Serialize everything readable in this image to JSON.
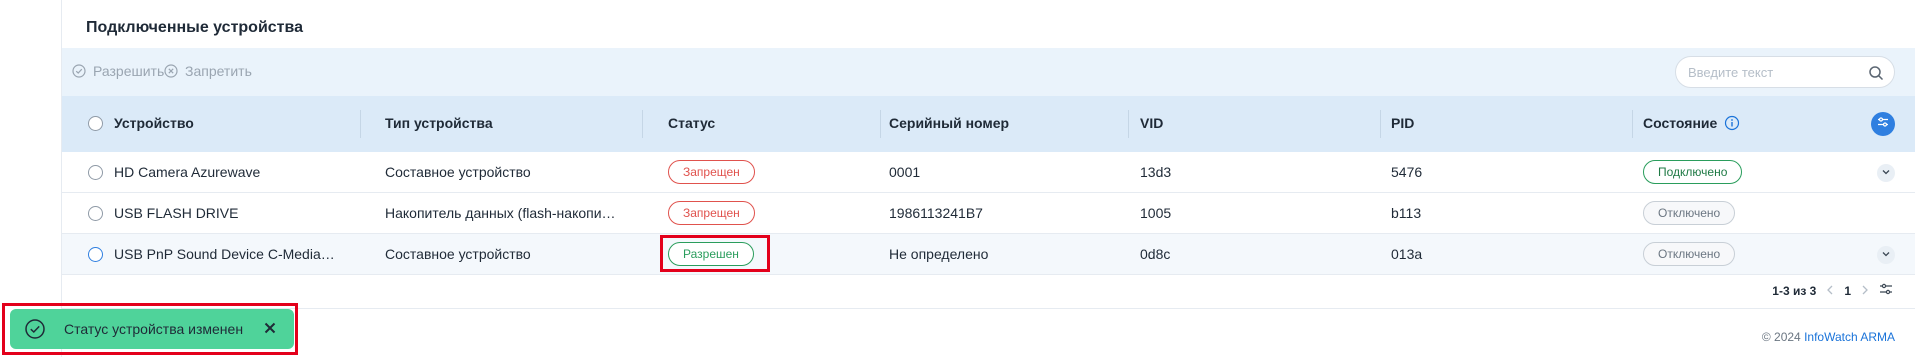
{
  "section": {
    "title": "Подключенные устройства"
  },
  "toolbar": {
    "allow_label": "Разрешить",
    "deny_label": "Запретить",
    "search_placeholder": "Введите текст"
  },
  "table": {
    "headers": {
      "device": "Устройство",
      "type": "Тип устройства",
      "status": "Статус",
      "serial": "Серийный номер",
      "vid": "VID",
      "pid": "PID",
      "state": "Состояние"
    },
    "rows": [
      {
        "device": "HD Camera Azurewave",
        "type": "Составное устройство",
        "status": "Запрещен",
        "serial": "0001",
        "vid": "13d3",
        "pid": "5476",
        "state": "Подключено"
      },
      {
        "device": "USB FLASH DRIVE",
        "type": "Накопитель данных (flash-накопи…",
        "status": "Запрещен",
        "serial": "1986113241B7",
        "vid": "1005",
        "pid": "b113",
        "state": "Отключено"
      },
      {
        "device": "USB PnP Sound Device C-Media…",
        "type": "Составное устройство",
        "status": "Разрешен",
        "serial": "Не определено",
        "vid": "0d8c",
        "pid": "013a",
        "state": "Отключено"
      }
    ]
  },
  "pagination": {
    "range": "1-3 из 3",
    "page": "1"
  },
  "footer": {
    "copyright_prefix": "© 2024",
    "brand": "InfoWatch ARMA"
  },
  "toast": {
    "message": "Статус устройства изменен"
  },
  "colors": {
    "accent": "#1a73d9",
    "denied": "#e0524d",
    "allowed": "#2a9d5c",
    "toast_bg": "#4fd39a",
    "highlight": "#e3001b"
  },
  "icons": [
    "check-circle-icon",
    "x-circle-icon",
    "search-icon",
    "info-icon",
    "settings-sliders-icon",
    "chevron-down-icon",
    "chevron-left-icon",
    "chevron-right-icon",
    "close-icon"
  ]
}
